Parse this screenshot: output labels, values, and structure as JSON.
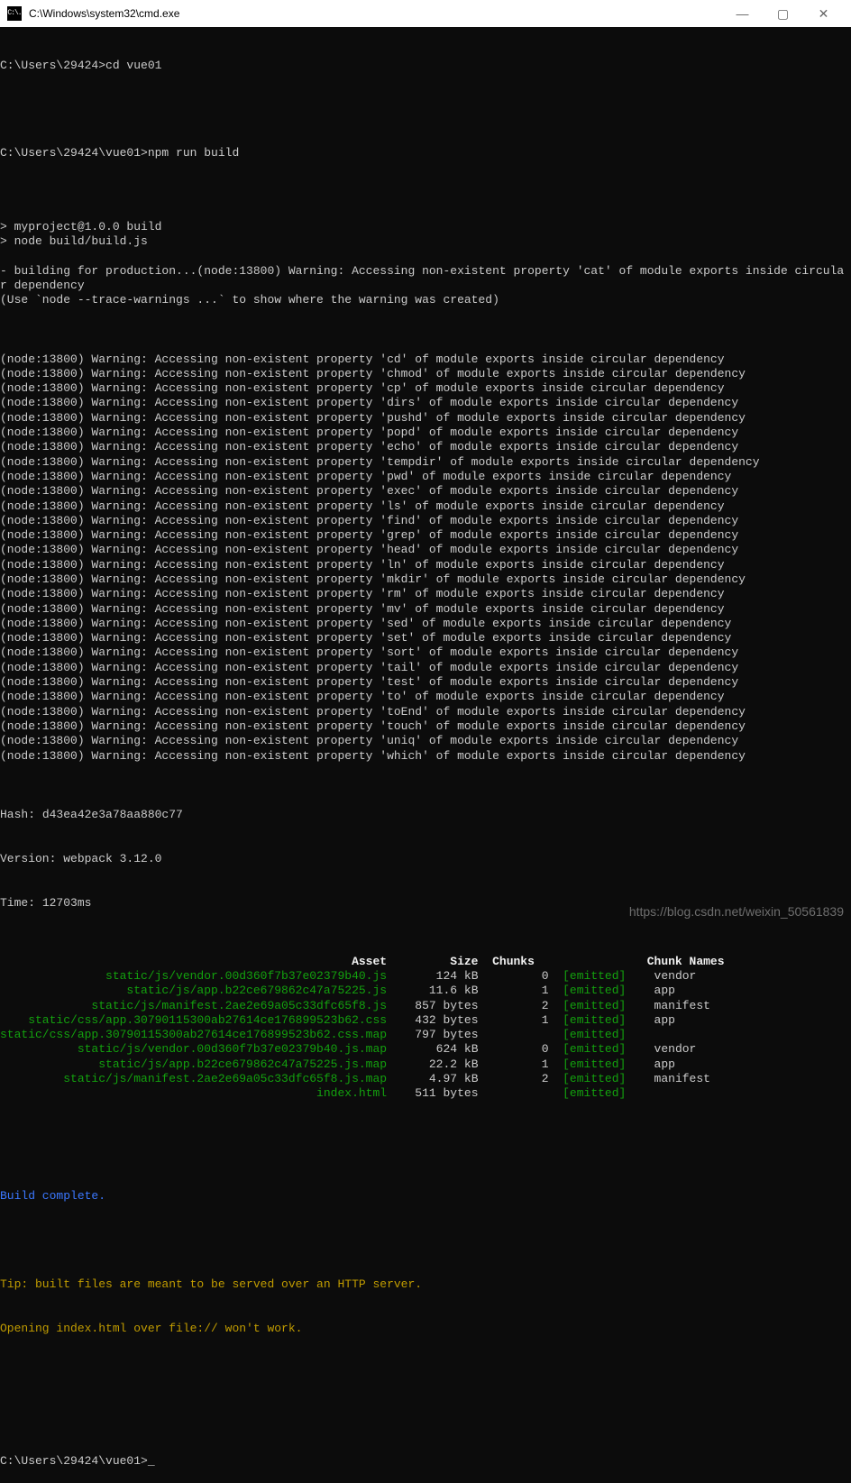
{
  "window": {
    "title": "C:\\Windows\\system32\\cmd.exe",
    "icon_text": "C:\\."
  },
  "prompts": [
    {
      "path": "C:\\Users\\29424>",
      "cmd": "cd vue01"
    },
    {
      "path": "C:\\Users\\29424\\vue01>",
      "cmd": "npm run build"
    }
  ],
  "prebuild": [
    "",
    "> myproject@1.0.0 build",
    "> node build/build.js",
    "",
    "- building for production...(node:13800) Warning: Accessing non-existent property 'cat' of module exports inside circula",
    "r dependency",
    "(Use `node --trace-warnings ...` to show where the warning was created)"
  ],
  "warn_props": [
    "cd",
    "chmod",
    "cp",
    "dirs",
    "pushd",
    "popd",
    "echo",
    "tempdir",
    "pwd",
    "exec",
    "ls",
    "find",
    "grep",
    "head",
    "ln",
    "mkdir",
    "rm",
    "mv",
    "sed",
    "set",
    "sort",
    "tail",
    "test",
    "to",
    "toEnd",
    "touch",
    "uniq",
    "which"
  ],
  "warn_prefix": "(node:13800) Warning: Accessing non-existent property '",
  "warn_suffix": "' of module exports inside circular dependency",
  "build_meta": {
    "hash_label": "Hash: ",
    "hash": "d43ea42e3a78aa880c77",
    "version_label": "Version: ",
    "version": "webpack 3.12.0",
    "time_label": "Time: ",
    "time": "12703ms"
  },
  "table": {
    "headers": [
      "Asset",
      "Size",
      "Chunks",
      "",
      "Chunk Names"
    ],
    "rows": [
      {
        "asset": "static/js/vendor.00d360f7b37e02379b40.js",
        "size": "124 kB",
        "chunks": "0",
        "emitted": "[emitted]",
        "names": "vendor"
      },
      {
        "asset": "static/js/app.b22ce679862c47a75225.js",
        "size": "11.6 kB",
        "chunks": "1",
        "emitted": "[emitted]",
        "names": "app"
      },
      {
        "asset": "static/js/manifest.2ae2e69a05c33dfc65f8.js",
        "size": "857 bytes",
        "chunks": "2",
        "emitted": "[emitted]",
        "names": "manifest"
      },
      {
        "asset": "static/css/app.30790115300ab27614ce176899523b62.css",
        "size": "432 bytes",
        "chunks": "1",
        "emitted": "[emitted]",
        "names": "app"
      },
      {
        "asset": "static/css/app.30790115300ab27614ce176899523b62.css.map",
        "size": "797 bytes",
        "chunks": "",
        "emitted": "[emitted]",
        "names": ""
      },
      {
        "asset": "static/js/vendor.00d360f7b37e02379b40.js.map",
        "size": "624 kB",
        "chunks": "0",
        "emitted": "[emitted]",
        "names": "vendor"
      },
      {
        "asset": "static/js/app.b22ce679862c47a75225.js.map",
        "size": "22.2 kB",
        "chunks": "1",
        "emitted": "[emitted]",
        "names": "app"
      },
      {
        "asset": "static/js/manifest.2ae2e69a05c33dfc65f8.js.map",
        "size": "4.97 kB",
        "chunks": "2",
        "emitted": "[emitted]",
        "names": "manifest"
      },
      {
        "asset": "index.html",
        "size": "511 bytes",
        "chunks": "",
        "emitted": "[emitted]",
        "names": ""
      }
    ]
  },
  "footer": {
    "complete": "Build complete.",
    "tip1": "Tip: built files are meant to be served over an HTTP server.",
    "tip2": "Opening index.html over file:// won't work."
  },
  "final_prompt": {
    "path": "C:\\Users\\29424\\vue01>",
    "cmd": ""
  },
  "watermark": "https://blog.csdn.net/weixin_50561839"
}
